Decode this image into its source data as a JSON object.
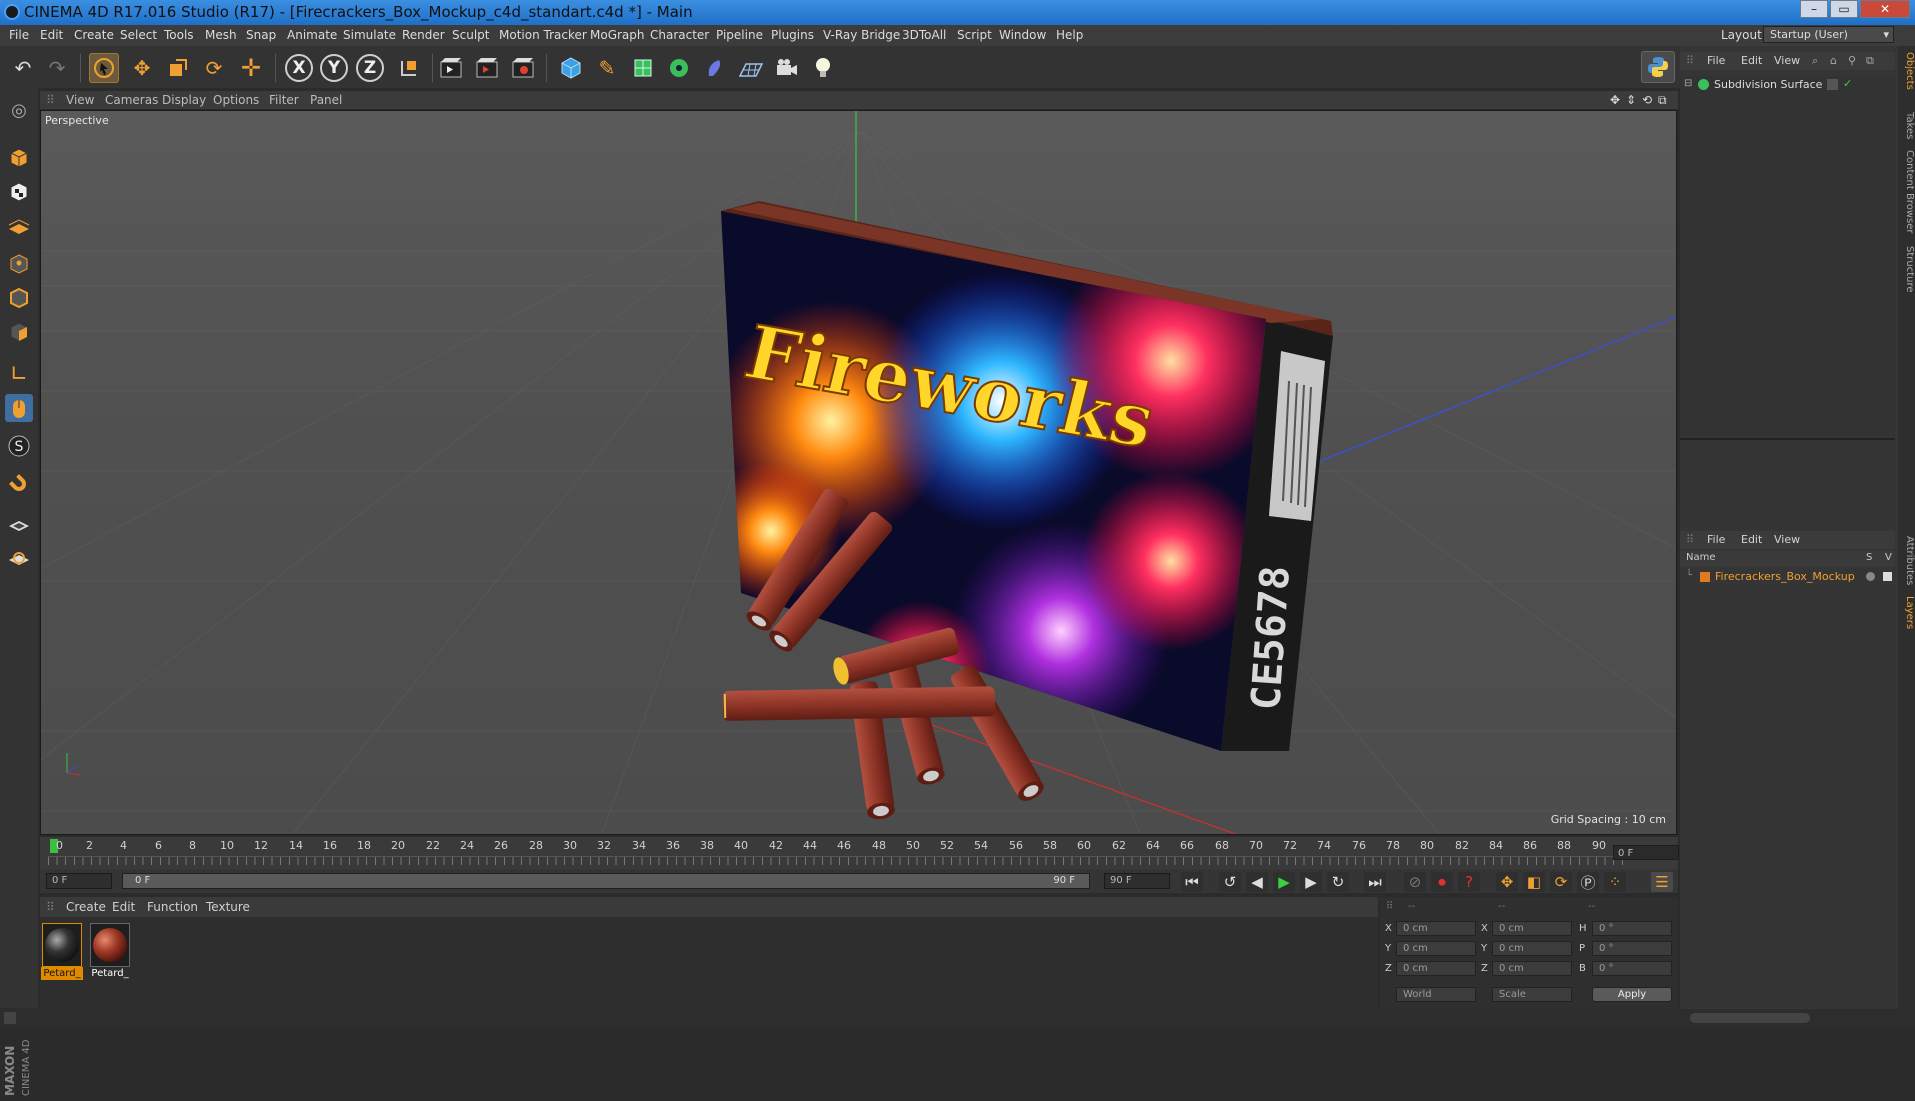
{
  "window": {
    "title": "CINEMA 4D R17.016 Studio (R17) - [Firecrackers_Box_Mockup_c4d_standart.c4d *] - Main",
    "buttons": {
      "minimize": "–",
      "maximize": "▭",
      "close": "✕"
    }
  },
  "menubar": {
    "items": [
      "File",
      "Edit",
      "Create",
      "Select",
      "Tools",
      "Mesh",
      "Snap",
      "Animate",
      "Simulate",
      "Render",
      "Sculpt",
      "Motion Tracker",
      "MoGraph",
      "Character",
      "Pipeline",
      "Plugins",
      "V-Ray Bridge",
      "3DToAll",
      "Script",
      "Window",
      "Help"
    ],
    "layout_label": "Layout:",
    "layout_value": "Startup (User)"
  },
  "toolbar": {
    "axis_x": "X",
    "axis_y": "Y",
    "axis_z": "Z"
  },
  "viewport": {
    "menu": [
      "View",
      "Cameras",
      "Display",
      "Options",
      "Filter",
      "Panel"
    ],
    "camera_label": "Perspective",
    "grid_spacing": "Grid Spacing : 10 cm",
    "box_text": "Fireworks",
    "box_side_text": "CE5678"
  },
  "timeline": {
    "ticks": [
      "0",
      "2",
      "4",
      "6",
      "8",
      "10",
      "12",
      "14",
      "16",
      "18",
      "20",
      "22",
      "24",
      "26",
      "28",
      "30",
      "32",
      "34",
      "36",
      "38",
      "40",
      "42",
      "44",
      "46",
      "48",
      "50",
      "52",
      "54",
      "56",
      "58",
      "60",
      "62",
      "64",
      "66",
      "68",
      "70",
      "72",
      "74",
      "76",
      "78",
      "80",
      "82",
      "84",
      "86",
      "88",
      "90"
    ],
    "current_frame": "0 F",
    "start_frame": "0 F",
    "range_start": "0 F",
    "range_end": "90 F",
    "end_frame": "90 F"
  },
  "materials": {
    "menu": [
      "Create",
      "Edit",
      "Function",
      "Texture"
    ],
    "items": [
      {
        "name": "Petard_",
        "selected": true
      },
      {
        "name": "Petard_",
        "selected": false
      }
    ]
  },
  "coordinates": {
    "header": [
      "--",
      "--",
      "--"
    ],
    "rows": [
      {
        "pos_label": "X",
        "pos": "0 cm",
        "size_label": "X",
        "size": "0 cm",
        "rot_label": "H",
        "rot": "0 °"
      },
      {
        "pos_label": "Y",
        "pos": "0 cm",
        "size_label": "Y",
        "size": "0 cm",
        "rot_label": "P",
        "rot": "0 °"
      },
      {
        "pos_label": "Z",
        "pos": "0 cm",
        "size_label": "Z",
        "size": "0 cm",
        "rot_label": "B",
        "rot": "0 °"
      }
    ],
    "space": "World",
    "mode": "Scale",
    "apply_label": "Apply"
  },
  "objects_panel": {
    "menu": [
      "File",
      "Edit",
      "View"
    ],
    "items": [
      {
        "name": "Subdivision Surface"
      }
    ]
  },
  "layers_panel": {
    "menu": [
      "File",
      "Edit",
      "View"
    ],
    "columns": {
      "name": "Name",
      "s": "S",
      "v": "V"
    },
    "items": [
      {
        "name": "Firecrackers_Box_Mockup",
        "color": "#e07a20"
      }
    ]
  },
  "side_tabs": [
    "Objects",
    "Takes",
    "Content Browser",
    "Structure",
    "Attributes",
    "Layers"
  ],
  "branding": {
    "maxon": "MAXON",
    "cinema": "CINEMA 4D"
  },
  "colors": {
    "accent": "#f0a030",
    "selection": "#e08a00",
    "title_bar": "#2a7fd8"
  }
}
